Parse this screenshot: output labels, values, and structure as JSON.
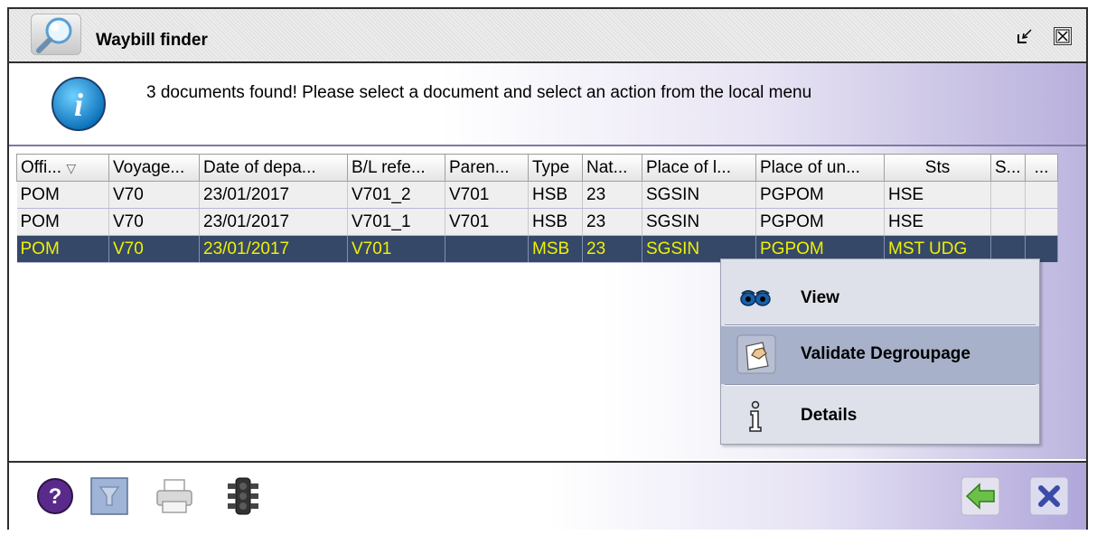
{
  "window": {
    "title": "Waybill finder",
    "title_icon": "magnifier-icon",
    "controls": [
      "minimize-icon",
      "close-icon"
    ]
  },
  "info": {
    "icon": "info-icon",
    "message": "3 documents found! Please select a document and select an action from the local menu"
  },
  "table": {
    "columns": [
      "Offi...",
      "Voyage...",
      "Date of depa...",
      "B/L refe...",
      "Paren...",
      "Type",
      "Nat...",
      "Place of l...",
      "Place of un...",
      "Sts",
      "S...",
      "..."
    ],
    "sort_indicator": "▽",
    "rows": [
      [
        "POM",
        "V70",
        "23/01/2017",
        "V701_2",
        "V701",
        "HSB",
        "23",
        "SGSIN",
        "PGPOM",
        "HSE",
        "",
        ""
      ],
      [
        "POM",
        "V70",
        "23/01/2017",
        "V701_1",
        "V701",
        "HSB",
        "23",
        "SGSIN",
        "PGPOM",
        "HSE",
        "",
        ""
      ],
      [
        "POM",
        "V70",
        "23/01/2017",
        "V701",
        "",
        "MSB",
        "23",
        "SGSIN",
        "PGPOM",
        "MST UDG",
        "",
        ""
      ]
    ],
    "selected_row": 2
  },
  "context_menu": {
    "items": [
      {
        "label": "View",
        "icon": "eyes-icon"
      },
      {
        "label": "Validate Degroupage",
        "icon": "validate-hand-icon"
      },
      {
        "label": "Details",
        "icon": "info-i-icon"
      }
    ],
    "highlighted": 1
  },
  "toolbar": {
    "buttons": [
      "help-icon",
      "filter-icon",
      "print-icon",
      "traffic-light-icon",
      "back-arrow-icon",
      "close-x-icon"
    ]
  },
  "colors": {
    "selection_bg": "#354868",
    "selection_text": "#f0f000",
    "menu_highlight": "#a7b1c9",
    "panel_gradient_end": "#b0a6da"
  }
}
